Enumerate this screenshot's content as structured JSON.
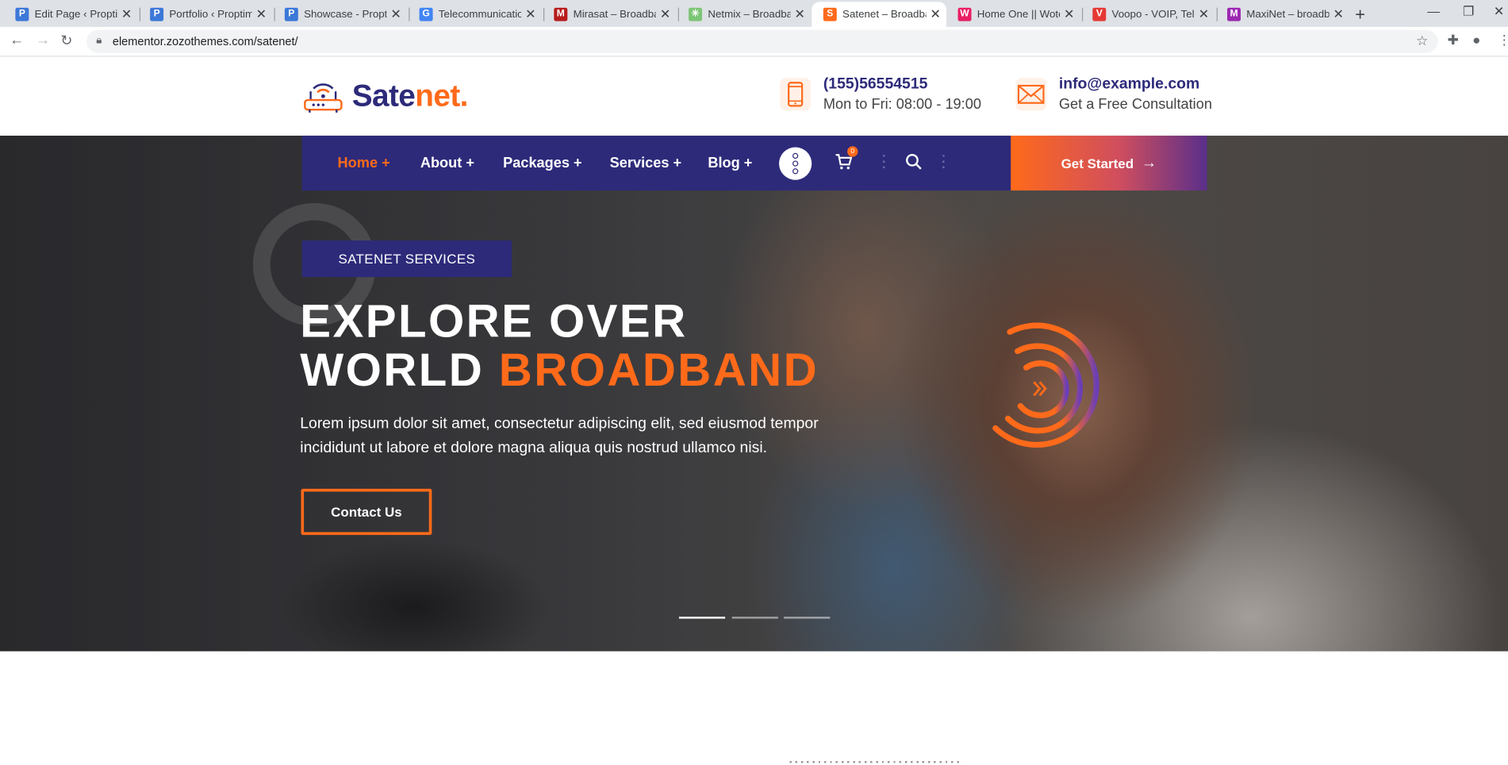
{
  "browser": {
    "tabs": [
      {
        "title": "Edit Page ‹ Proptimi",
        "fav": "P",
        "color": "#3c78d8"
      },
      {
        "title": "Portfolio ‹ Proptimi",
        "fav": "P",
        "color": "#3c78d8"
      },
      {
        "title": "Showcase - Proptim",
        "fav": "P",
        "color": "#3c78d8"
      },
      {
        "title": "Telecommunication",
        "fav": "G",
        "color": "#4285f4"
      },
      {
        "title": "Mirasat – Broadban",
        "fav": "M",
        "color": "#b71c1c"
      },
      {
        "title": "Netmix – Broadban",
        "fav": "✳",
        "color": "#7cc576"
      },
      {
        "title": "Satenet – Broadban",
        "fav": "S",
        "color": "#ff6a1a"
      },
      {
        "title": "Home One || Wotec",
        "fav": "W",
        "color": "#e91e63"
      },
      {
        "title": "Voopo - VOIP, Telec",
        "fav": "V",
        "color": "#e53935"
      },
      {
        "title": "MaxiNet – broadba",
        "fav": "M",
        "color": "#9c27b0"
      }
    ],
    "url": "elementor.zozothemes.com/satenet/"
  },
  "site": {
    "logo_main": "Sate",
    "logo_accent": "net.",
    "phone": "(155)56554515",
    "hours": "Mon to Fri: 08:00 - 19:00",
    "email": "info@example.com",
    "email_sub": "Get a Free Consultation"
  },
  "nav": {
    "items": [
      {
        "label": "Home +"
      },
      {
        "label": "About +"
      },
      {
        "label": "Packages +"
      },
      {
        "label": "Services +"
      },
      {
        "label": "Blog +"
      }
    ],
    "cart_count": "0",
    "cta": "Get Started"
  },
  "hero": {
    "badge": "SATENET SERVICES",
    "title_line1": "EXPLORE OVER",
    "title_line2_white": "WORLD ",
    "title_line2_accent": "BROADBAND",
    "description": "Lorem ipsum dolor sit amet, consectetur adipiscing elit, sed eiusmod tempor incididunt ut labore et dolore magna aliqua quis nostrud ullamco nisi.",
    "button": "Contact Us",
    "slides": 3,
    "active_slide": 1
  },
  "colors": {
    "brand_navy": "#2d2a7a",
    "brand_orange": "#ff6a1a"
  }
}
